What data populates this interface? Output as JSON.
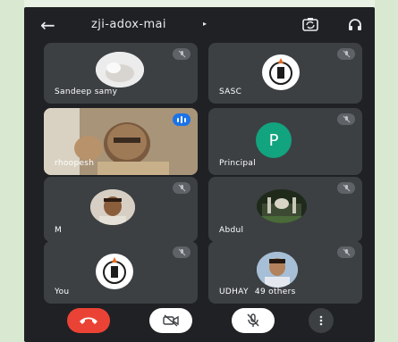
{
  "header": {
    "back_icon": "arrow-left-icon",
    "title": "zji-adox-mai",
    "caret": "▸",
    "switch_camera_icon": "camera-switch-icon",
    "audio_icon": "headphones-icon"
  },
  "participants": [
    {
      "name": "Sandeep samy",
      "muted": true,
      "avatar": "photo"
    },
    {
      "name": "SASC",
      "muted": true,
      "avatar": "logo"
    },
    {
      "name": "rhoopesh",
      "muted": false,
      "speaking": true,
      "avatar": "video"
    },
    {
      "name": "Principal",
      "muted": true,
      "avatar": "letter",
      "letter": "P",
      "avatar_color": "#12a37f"
    },
    {
      "name": "M",
      "muted": true,
      "avatar": "photo"
    },
    {
      "name": "Abdul",
      "muted": true,
      "avatar": "photo"
    },
    {
      "name": "You",
      "muted": true,
      "avatar": "logo"
    },
    {
      "name": "UDHAY",
      "muted": true,
      "avatar": "photo",
      "others_label": "49 others"
    }
  ],
  "controls": {
    "end_call_icon": "phone-hangup-icon",
    "camera_off_icon": "video-off-icon",
    "mic_off_icon": "mic-off-icon",
    "more_icon": "more-vertical-icon"
  },
  "colors": {
    "background": "#202124",
    "tile": "#3c4043",
    "end_call": "#ea4335",
    "speaking": "#1a73e8"
  }
}
